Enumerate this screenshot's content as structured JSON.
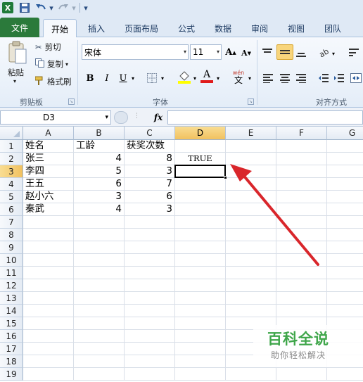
{
  "quick_access": {
    "undo_icon": "undo-icon",
    "redo_icon": "redo-icon",
    "save_icon": "save-icon"
  },
  "tabs": [
    {
      "label": "文件"
    },
    {
      "label": "开始"
    },
    {
      "label": "插入"
    },
    {
      "label": "页面布局"
    },
    {
      "label": "公式"
    },
    {
      "label": "数据"
    },
    {
      "label": "审阅"
    },
    {
      "label": "视图"
    },
    {
      "label": "团队"
    }
  ],
  "clipboard": {
    "paste_label": "粘贴",
    "cut_label": "剪切",
    "copy_label": "复制",
    "format_painter_label": "格式刷",
    "group_label": "剪贴板"
  },
  "font": {
    "name": "宋体",
    "size": "11",
    "bold": "B",
    "italic": "I",
    "underline": "U",
    "grow": "A",
    "shrink": "A",
    "font_color_letter": "A",
    "phonetic_label": "wén",
    "phonetic_char": "文",
    "group_label": "字体"
  },
  "alignment": {
    "group_label": "对齐方式"
  },
  "formula_bar": {
    "name_box": "D3",
    "fx": "fx",
    "formula": ""
  },
  "columns": [
    "A",
    "B",
    "C",
    "D",
    "E",
    "F",
    "G"
  ],
  "rows": [
    "1",
    "2",
    "3",
    "4",
    "5",
    "6",
    "7",
    "8",
    "9",
    "10",
    "11",
    "12",
    "13",
    "14",
    "15",
    "16",
    "17",
    "18",
    "19"
  ],
  "cells": {
    "A1": "姓名",
    "B1": "工龄",
    "C1": "获奖次数",
    "A2": "张三",
    "B2": "4",
    "C2": "8",
    "D2": "TRUE",
    "A3": "李四",
    "B3": "5",
    "C3": "3",
    "A4": "王五",
    "B4": "6",
    "C4": "7",
    "A5": "赵小六",
    "B5": "3",
    "C5": "6",
    "A6": "秦武",
    "B6": "4",
    "C6": "3"
  },
  "watermark": {
    "title": "百科全说",
    "subtitle": "助你轻松解决"
  },
  "colors": {
    "excel_green": "#2b7a3b",
    "annotation_red": "#d9262b",
    "selection_orange": "#f1c15f"
  }
}
